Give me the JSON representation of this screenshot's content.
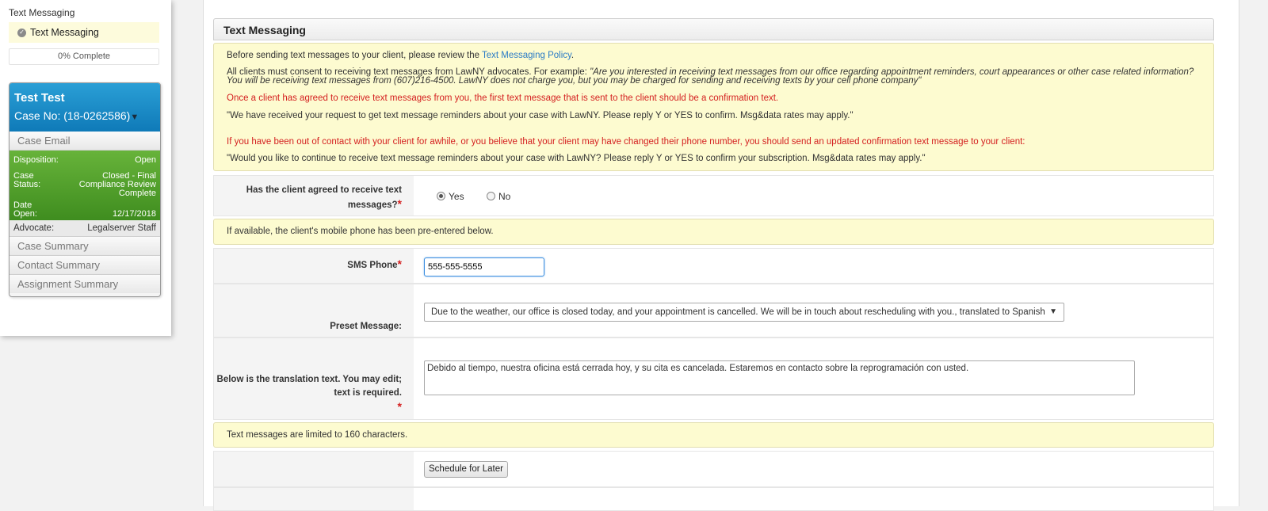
{
  "sidebar": {
    "section_title": "Text Messaging",
    "step_label": "Text Messaging",
    "progress": "0% Complete",
    "progress_value": 0,
    "card": {
      "client_name": "Test Test",
      "case_no": "Case No: (18-0262586)",
      "case_email": "Case Email",
      "disposition_label": "Disposition:",
      "disposition_value": "Open",
      "status_label": "Case Status:",
      "status_value": "Closed - Final Compliance Review Complete",
      "date_label": "Date Open:",
      "date_value": "12/17/2018",
      "advocate_label": "Advocate:",
      "advocate_value": "Legalserver Staff",
      "links": [
        "Case Summary",
        "Contact Summary",
        "Assignment Summary"
      ]
    }
  },
  "main": {
    "title": "Text Messaging",
    "notice": {
      "intro_prefix": "Before sending text messages to your client, please review the",
      "intro_link": "Text Messaging Policy",
      "intro_suffix": ".",
      "consent_prefix": "All clients must consent to receiving text messages from LawNY advocates. For example: ",
      "consent_example": "\"Are you interested in receiving text messages from our office regarding appointment reminders, court appearances or other case related information? You will be receiving text messages from (607)216-4500. LawNY does not charge you, but you may be charged for sending and receiving texts by your cell phone company\"",
      "confirm_red": "Once a client has agreed to receive text messages from you, the first text message that is sent to the client should be a confirmation text.",
      "confirm_quote": "\"We have received your request to get text message reminders about your case with LawNY. Please reply Y or YES to confirm. Msg&data rates may apply.\"",
      "update_red": "If you have been out of contact with your client for awhile, or you believe that your client may have changed their phone number, you should send an updated confirmation text message to your client:",
      "update_quote": "\"Would you like to continue to receive text message reminders about your case with LawNY? Please reply Y or YES to confirm your subscription. Msg&data rates may apply.\""
    },
    "agreed": {
      "label": "Has the client agreed to receive text messages?",
      "required": "*",
      "options": [
        "Yes",
        "No"
      ],
      "selected": "Yes"
    },
    "phone_notice": "If available, the client's mobile phone has been pre-entered below.",
    "sms_phone": {
      "label": "SMS Phone",
      "required": "*",
      "value": "555-555-5555"
    },
    "preset": {
      "label": "Preset Message:",
      "selected": "Due to the weather, our office is closed today, and your appointment is cancelled. We will be in touch about rescheduling with you., translated to Spanish"
    },
    "translation": {
      "label": "Below is the translation text. You may edit; text is required.",
      "required": "*",
      "value": "Debido al tiempo, nuestra oficina está cerrada hoy, y su cita es cancelada. Estaremos en contacto sobre la reprogramación con usted."
    },
    "limit_notice": "Text messages are limited to 160 characters.",
    "schedule_button": "Schedule for Later"
  },
  "colors": {
    "card_header": "#1a8cc9",
    "card_green": "#54a22d",
    "notice_bg": "#fdfbd0",
    "required": "#d42020",
    "link": "#2b7bc6"
  },
  "icons": [
    "check-icon",
    "caret-down-icon",
    "radio-icon",
    "dropdown-arrow-icon",
    "resize-handle-icon"
  ]
}
